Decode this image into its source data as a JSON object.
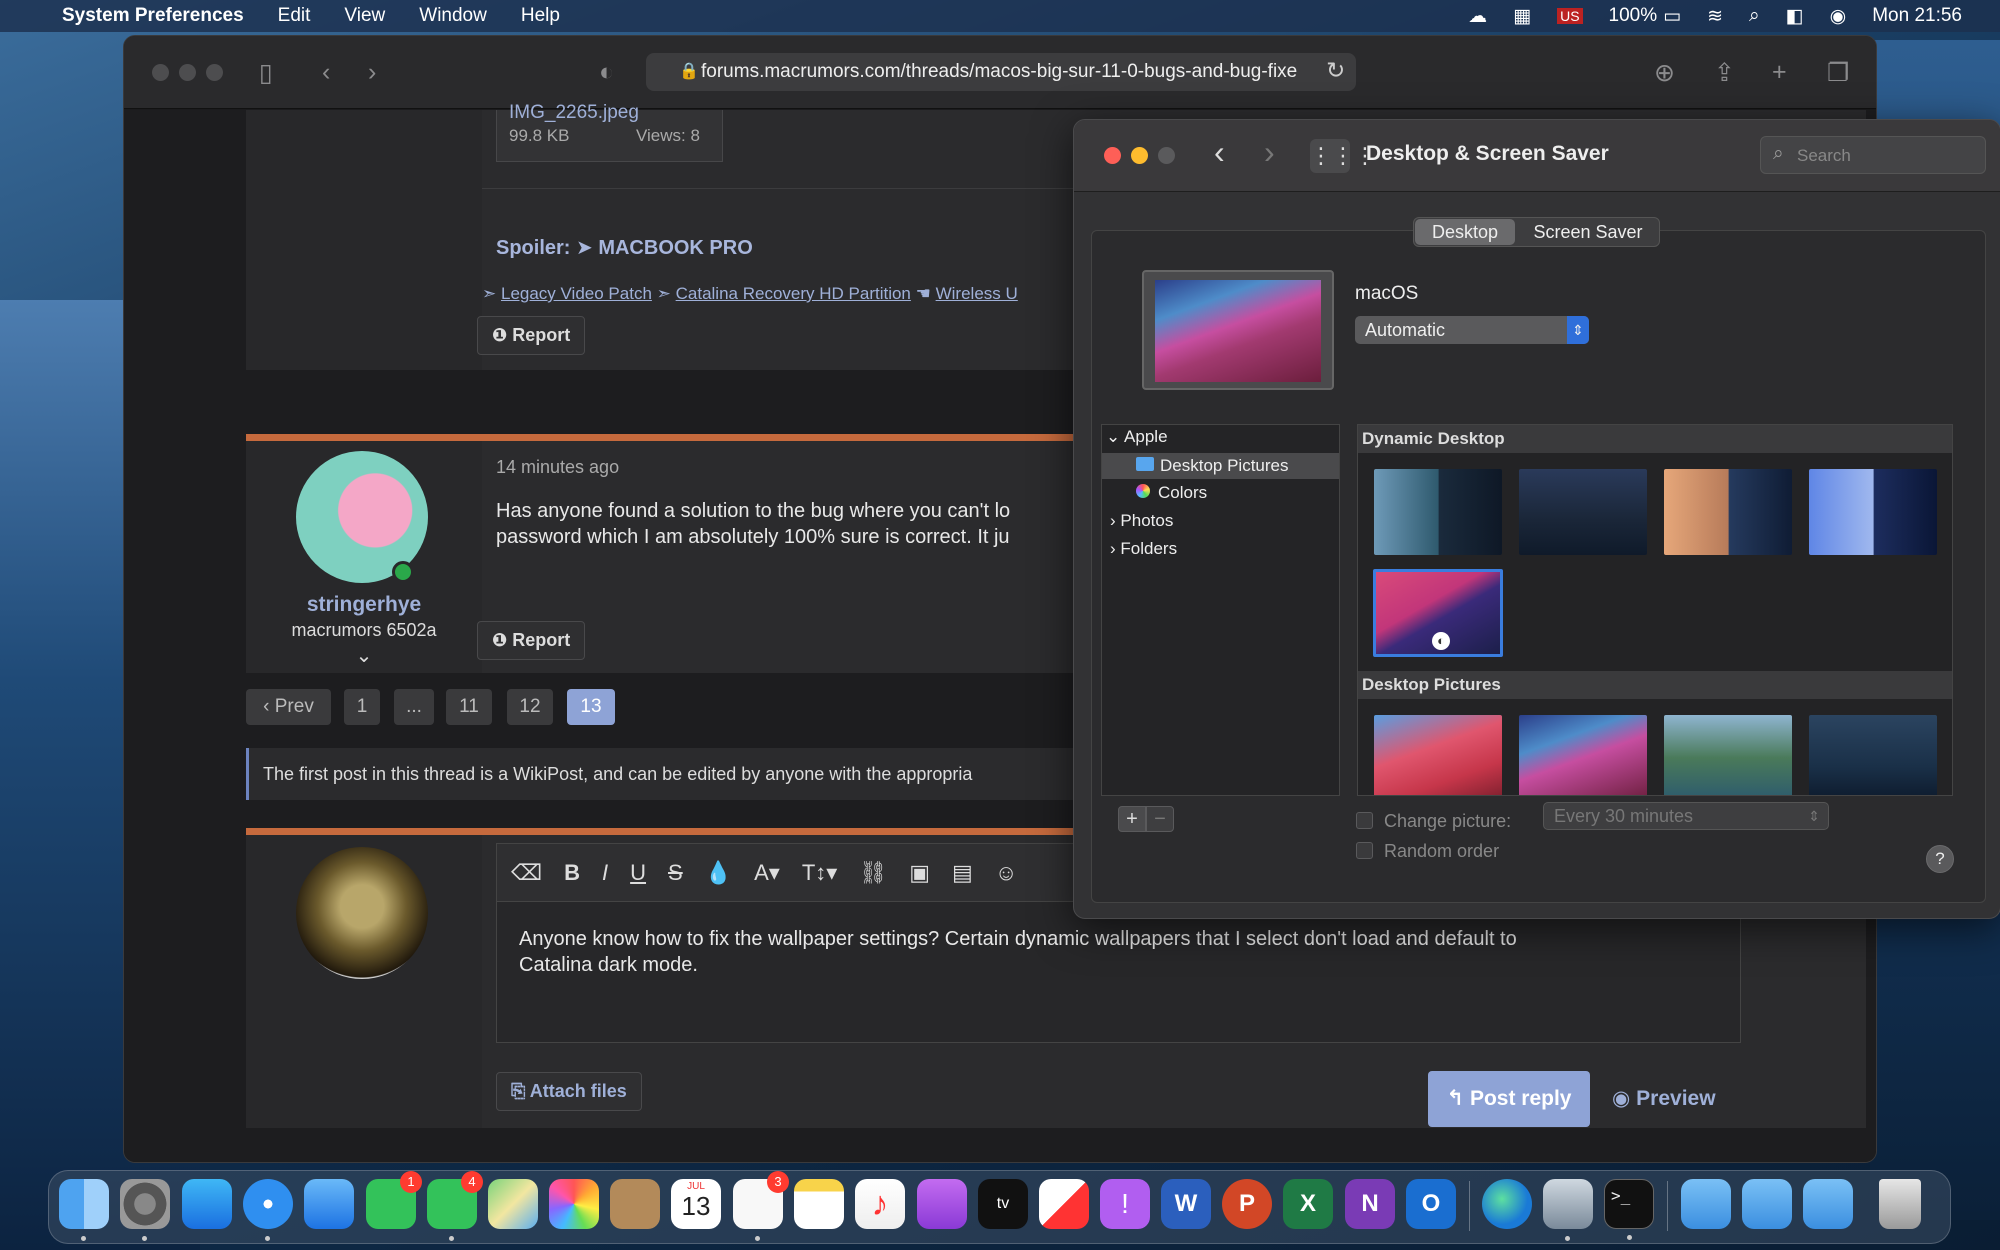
{
  "menubar": {
    "app": "System Preferences",
    "items": [
      "Edit",
      "View",
      "Window",
      "Help"
    ],
    "battery": "100%",
    "clock": "Mon 21:56"
  },
  "browser": {
    "url": "forums.macrumors.com/threads/macos-big-sur-11-0-bugs-and-bug-fixe",
    "attachment": {
      "name": "IMG_2265.jpeg",
      "size": "99.8 KB",
      "views": "Views: 8"
    },
    "spoiler": "Spoiler: ➤ MACBOOK PRO",
    "links": [
      {
        "prefix": "➣",
        "text": "Legacy Video Patch"
      },
      {
        "prefix": "➣",
        "text": "Catalina Recovery HD Partition"
      },
      {
        "prefix": "☚",
        "text": "Wireless U"
      }
    ],
    "report_label": "Report",
    "post": {
      "time": "14 minutes ago",
      "line1": "Has anyone found a solution to the bug where you can't lo",
      "line2": "password which I am absolutely 100% sure is correct. It ju"
    },
    "user": {
      "name": "stringerhye",
      "rank": "macrumors 6502a"
    },
    "pagination": [
      "‹ Prev",
      "1",
      "...",
      "11",
      "12",
      "13"
    ],
    "wiki_notice": "The first post in this thread is a WikiPost, and can be edited by anyone with the appropria",
    "reply_line1": "Anyone know how to fix the wallpaper settings? Certain dynamic wallpapers that I select don't load and default to",
    "reply_line2": "Catalina dark mode.",
    "attach_label": "Attach files",
    "post_reply": "Post reply",
    "preview": "Preview"
  },
  "prefs": {
    "title": "Desktop & Screen Saver",
    "search_placeholder": "Search",
    "tabs": [
      "Desktop",
      "Screen Saver"
    ],
    "wallpaper_name": "macOS",
    "appearance": "Automatic",
    "sources": {
      "apple": "Apple",
      "desktop_pictures": "Desktop Pictures",
      "colors": "Colors",
      "photos": "Photos",
      "folders": "Folders"
    },
    "sections": [
      "Dynamic Desktop",
      "Desktop Pictures"
    ],
    "change_picture": "Change picture:",
    "interval": "Every 30 minutes",
    "random_order": "Random order",
    "help": "?"
  },
  "dock": {
    "calendar_month": "JUL",
    "calendar_day": "13",
    "badges": {
      "facetime": "1",
      "messages": "4",
      "reminders": "3"
    }
  }
}
